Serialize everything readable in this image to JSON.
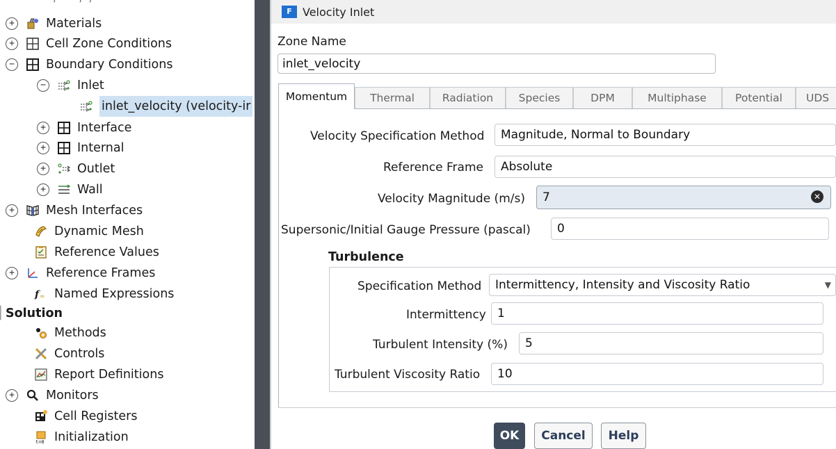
{
  "tree": {
    "cutoff_text": "— — , — , ,",
    "items": [
      {
        "label": "Materials",
        "icon": "materials-icon",
        "expander": "+"
      },
      {
        "label": "Cell Zone Conditions",
        "icon": "grid-icon",
        "expander": "+"
      },
      {
        "label": "Boundary Conditions",
        "icon": "grid-icon",
        "expander": "−"
      },
      {
        "label": "Inlet",
        "icon": "inlet-icon",
        "expander": "−"
      },
      {
        "label": "inlet_velocity (velocity-ir",
        "icon": "inlet-icon",
        "expander": ""
      },
      {
        "label": "Interface",
        "icon": "grid-icon",
        "expander": "+"
      },
      {
        "label": "Internal",
        "icon": "grid-icon",
        "expander": "+"
      },
      {
        "label": "Outlet",
        "icon": "outlet-icon",
        "expander": "+"
      },
      {
        "label": "Wall",
        "icon": "wall-icon",
        "expander": "+"
      },
      {
        "label": "Mesh Interfaces",
        "icon": "mesh-interfaces-icon",
        "expander": "+"
      },
      {
        "label": "Dynamic Mesh",
        "icon": "dynamic-mesh-icon",
        "expander": ""
      },
      {
        "label": "Reference Values",
        "icon": "reference-values-icon",
        "expander": ""
      },
      {
        "label": "Reference Frames",
        "icon": "reference-frames-icon",
        "expander": "+"
      },
      {
        "label": "Named Expressions",
        "icon": "function-icon",
        "expander": ""
      },
      {
        "label": "Solution",
        "icon": "",
        "expander": ""
      },
      {
        "label": "Methods",
        "icon": "methods-icon",
        "expander": ""
      },
      {
        "label": "Controls",
        "icon": "controls-icon",
        "expander": ""
      },
      {
        "label": "Report Definitions",
        "icon": "report-definitions-icon",
        "expander": ""
      },
      {
        "label": "Monitors",
        "icon": "magnifier-icon",
        "expander": "+"
      },
      {
        "label": "Cell Registers",
        "icon": "cell-registers-icon",
        "expander": ""
      },
      {
        "label": "Initialization",
        "icon": "initialization-icon",
        "expander": ""
      }
    ]
  },
  "dialog": {
    "title": "Velocity Inlet",
    "app_icon_letter": "F",
    "zone_name_label": "Zone Name",
    "zone_name_value": "inlet_velocity",
    "tabs": [
      "Momentum",
      "Thermal",
      "Radiation",
      "Species",
      "DPM",
      "Multiphase",
      "Potential",
      "UDS"
    ],
    "active_tab": "Momentum",
    "momentum": {
      "velocity_spec_label": "Velocity Specification Method",
      "velocity_spec_value": "Magnitude, Normal to Boundary",
      "reference_frame_label": "Reference Frame",
      "reference_frame_value": "Absolute",
      "velocity_magnitude_label": "Velocity Magnitude (m/s)",
      "velocity_magnitude_value": "7",
      "pressure_label": "Supersonic/Initial Gauge Pressure (pascal)",
      "pressure_value": "0"
    },
    "turbulence": {
      "heading": "Turbulence",
      "spec_method_label": "Specification Method",
      "spec_method_value": "Intermittency, Intensity and Viscosity Ratio",
      "intermittency_label": "Intermittency",
      "intermittency_value": "1",
      "intensity_label": "Turbulent Intensity (%)",
      "intensity_value": "5",
      "viscosity_ratio_label": "Turbulent Viscosity Ratio",
      "viscosity_ratio_value": "10"
    },
    "buttons": {
      "ok": "OK",
      "cancel": "Cancel",
      "help": "Help"
    }
  },
  "colors": {
    "splitter": "#4a4f57",
    "selection": "#cfe2f3",
    "primary_button": "#3f4c5c",
    "title_icon": "#1f6fd1"
  }
}
